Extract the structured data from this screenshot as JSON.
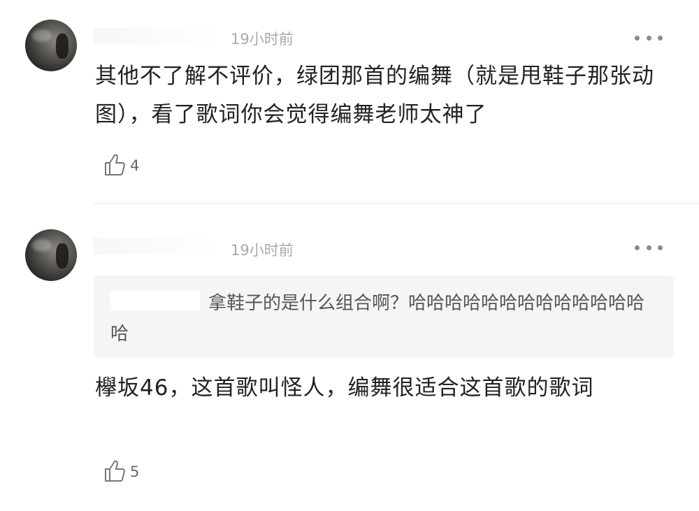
{
  "comments": [
    {
      "time": "19小时前",
      "text": "其他不了解不评价，绿团那首的编舞（就是甩鞋子那张动图），看了歌词你会觉得编舞老师太神了",
      "likes": "4",
      "icons": {
        "more": "more-dots-icon",
        "like": "thumbs-up-icon"
      }
    },
    {
      "time": "19小时前",
      "quote": "拿鞋子的是什么组合啊？哈哈哈哈哈哈哈哈哈哈哈哈哈哈",
      "text": "欅坂46，这首歌叫怪人，编舞很适合这首歌的歌词",
      "likes": "5",
      "icons": {
        "more": "more-dots-icon",
        "like": "thumbs-up-icon"
      }
    }
  ],
  "colors": {
    "time": "#a9a9a9",
    "text": "#222222",
    "quote_bg": "#f5f5f7"
  }
}
